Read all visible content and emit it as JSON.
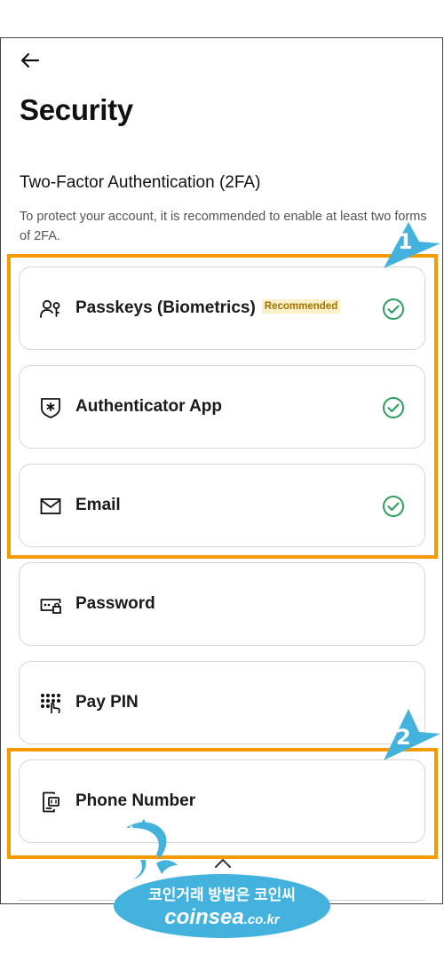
{
  "screen": {
    "title": "Security",
    "section_title": "Two-Factor Authentication (2FA)",
    "description": "To protect your account, it is recommended to enable at least two forms of 2FA."
  },
  "methods": [
    {
      "label": "Passkeys (Biometrics)",
      "badge": "Recommended",
      "icon": "passkey-icon",
      "enabled": true
    },
    {
      "label": "Authenticator App",
      "icon": "authenticator-shield-icon",
      "enabled": true
    },
    {
      "label": "Email",
      "icon": "envelope-icon",
      "enabled": true
    },
    {
      "label": "Password",
      "icon": "password-icon",
      "enabled": false
    },
    {
      "label": "Pay PIN",
      "icon": "keypad-icon",
      "enabled": false
    },
    {
      "label": "Phone Number",
      "icon": "phone-icon",
      "enabled": false
    }
  ],
  "annotations": {
    "marker1": "1",
    "marker2": "2",
    "highlight_color": "#f59b00",
    "marker_color": "#43b3dd"
  },
  "watermark": {
    "korean": "코인거래 방법은 코인씨",
    "domain": "coinsea",
    "tld": ".co.kr"
  },
  "colors": {
    "check": "#2a9d5c",
    "badge_bg": "#fdf0c8",
    "badge_text": "#a27200"
  }
}
